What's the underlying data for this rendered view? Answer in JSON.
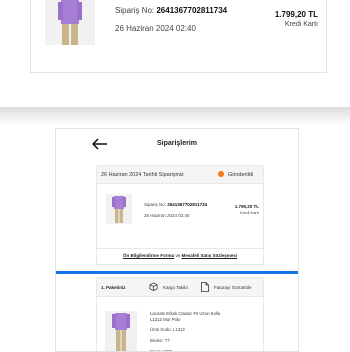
{
  "top_card": {
    "order_no_label": "Sipariş No:",
    "order_no": "2641367702811734",
    "date": "26 Haziran 2024 02:40",
    "amount": "1.799,20 TL",
    "payment": "Kredi Kartı"
  },
  "nav": {
    "title": "Siparişlerim"
  },
  "order": {
    "heading": "26 Haziran 2024 Tarihli Siparişiniz",
    "status": "Gönderildi",
    "order_no_label": "Sipariş No:",
    "order_no": "2641367702811734",
    "date": "26 Haziran 2024 02:40",
    "amount": "1.799,20 TL",
    "payment": "Kredi Kartı"
  },
  "info": {
    "link1": "Ön Bilgilendirme Formu",
    "connector": "ve",
    "link2": "Mesafeli Satış Sözleşmesi"
  },
  "package": {
    "title": "1. Paketiniz",
    "cargo_label": "Kargo Takibi",
    "invoice_label": "Faturayı Görüntüle",
    "product_name": "Lacoste Erkek Classic Fit Uzun Kollu L1212 Mor Polo",
    "product_code": "Ürün Kodu: L1312",
    "size": "Beden: T7",
    "color": "Renk: MOR"
  },
  "colors": {
    "status_dot": "#f27a1a",
    "divider_bar": "#1473e6",
    "shirt": "#a77ed6",
    "pants": "#c9b58a"
  }
}
